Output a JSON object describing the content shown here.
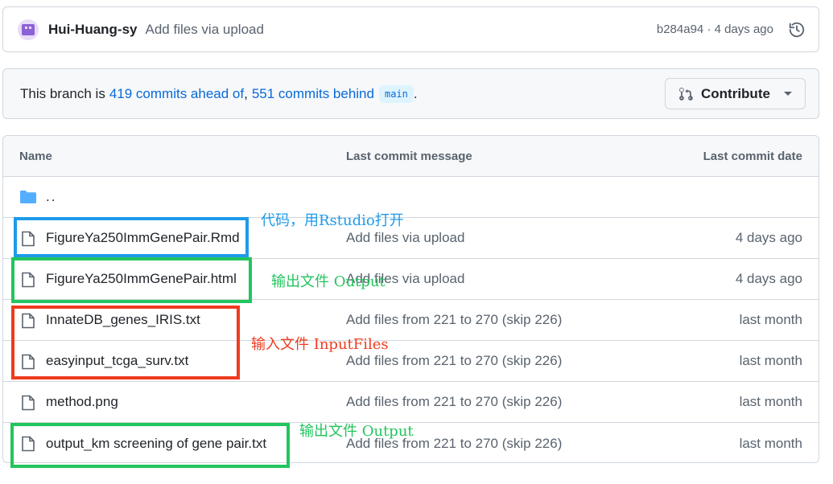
{
  "commit": {
    "author": "Hui-Huang-sy",
    "message": "Add files via upload",
    "meta": "b284a94 · 4 days ago"
  },
  "branch": {
    "prefix": "This branch is",
    "ahead": "419 commits ahead of",
    "separator": ",",
    "behind": "551 commits behind",
    "base": "main",
    "suffix": ".",
    "contribute_label": "Contribute"
  },
  "table": {
    "headers": {
      "name": "Name",
      "message": "Last commit message",
      "date": "Last commit date"
    },
    "parent_label": "..",
    "rows": [
      {
        "name": "FigureYa250ImmGenePair.Rmd",
        "message": "Add files via upload",
        "date": "4 days ago"
      },
      {
        "name": "FigureYa250ImmGenePair.html",
        "message": "Add files via upload",
        "date": "4 days ago"
      },
      {
        "name": "InnateDB_genes_IRIS.txt",
        "message": "Add files from 221 to 270 (skip 226)",
        "date": "last month"
      },
      {
        "name": "easyinput_tcga_surv.txt",
        "message": "Add files from 221 to 270 (skip 226)",
        "date": "last month"
      },
      {
        "name": "method.png",
        "message": "Add files from 221 to 270 (skip 226)",
        "date": "last month"
      },
      {
        "name": "output_km screening of gene pair.txt",
        "message": "Add files from 221 to 270 (skip 226)",
        "date": "last month"
      }
    ]
  },
  "annotations": [
    {
      "text": "代码，用Rstudio打开",
      "color": "#1e9be9"
    },
    {
      "text": "输出文件 Output",
      "color": "#22c55e"
    },
    {
      "text": "输入文件 InputFiles",
      "color": "#ef3b1f"
    },
    {
      "text": "输出文件 Output",
      "color": "#22c55e"
    }
  ],
  "colors": {
    "link": "#0969da",
    "annotation_blue": "#1e9be9",
    "annotation_green": "#22c55e",
    "annotation_red": "#ef3b1f",
    "folder": "#54aeff"
  }
}
